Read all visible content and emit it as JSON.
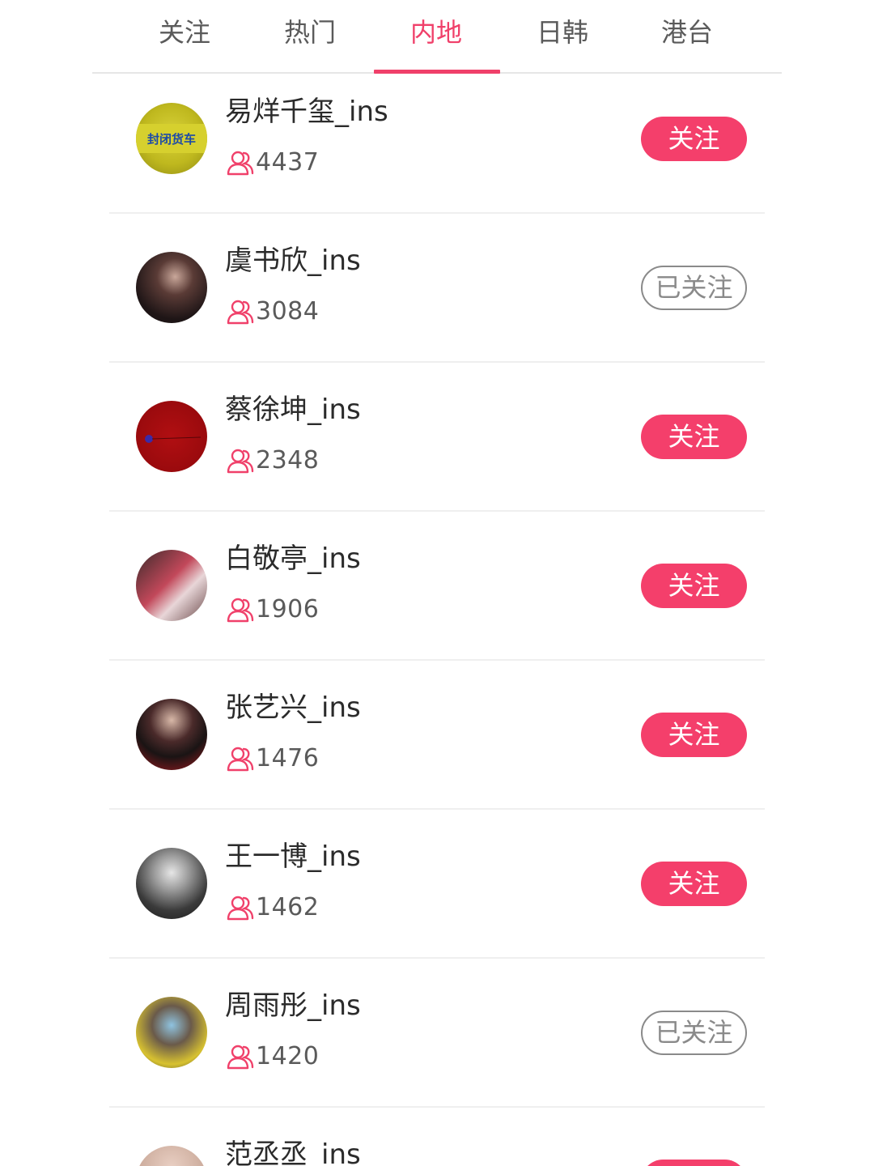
{
  "tabs": [
    {
      "label": "关注",
      "active": false
    },
    {
      "label": "热门",
      "active": false
    },
    {
      "label": "内地",
      "active": true
    },
    {
      "label": "日韩",
      "active": false
    },
    {
      "label": "港台",
      "active": false
    }
  ],
  "colors": {
    "accent": "#f43f6b",
    "tab_active": "#f0406a",
    "followed_border": "#8a8a8a"
  },
  "fans_icon": "user-group-icon",
  "avatar_badge_text": "封闭货车",
  "follow_label": "关注",
  "followed_label": "已关注",
  "rows": [
    {
      "name": "易烊千玺_ins",
      "fans": "4437",
      "state": "follow"
    },
    {
      "name": "虞书欣_ins",
      "fans": "3084",
      "state": "followed"
    },
    {
      "name": "蔡徐坤_ins",
      "fans": "2348",
      "state": "follow"
    },
    {
      "name": "白敬亭_ins",
      "fans": "1906",
      "state": "follow"
    },
    {
      "name": "张艺兴_ins",
      "fans": "1476",
      "state": "follow"
    },
    {
      "name": "王一博_ins",
      "fans": "1462",
      "state": "follow"
    },
    {
      "name": "周雨彤_ins",
      "fans": "1420",
      "state": "followed"
    },
    {
      "name": "范丞丞_ins",
      "fans": "",
      "state": "follow"
    }
  ]
}
